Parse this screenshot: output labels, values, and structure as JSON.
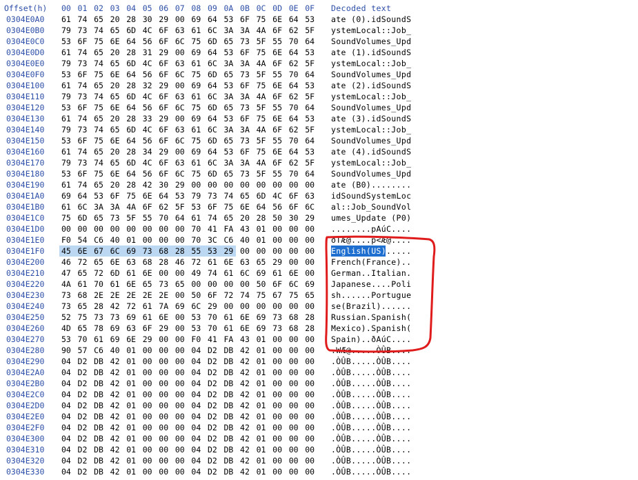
{
  "header": {
    "offset_label": "Offset(h)",
    "columns": [
      "00",
      "01",
      "02",
      "03",
      "04",
      "05",
      "06",
      "07",
      "08",
      "09",
      "0A",
      "0B",
      "0C",
      "0D",
      "0E",
      "0F"
    ],
    "decoded_label": "Decoded text"
  },
  "rows": [
    {
      "offset": "0304E0A0",
      "bytes": [
        "61",
        "74",
        "65",
        "20",
        "28",
        "30",
        "29",
        "00",
        "69",
        "64",
        "53",
        "6F",
        "75",
        "6E",
        "64",
        "53"
      ],
      "text": "ate (0).idSoundS"
    },
    {
      "offset": "0304E0B0",
      "bytes": [
        "79",
        "73",
        "74",
        "65",
        "6D",
        "4C",
        "6F",
        "63",
        "61",
        "6C",
        "3A",
        "3A",
        "4A",
        "6F",
        "62",
        "5F"
      ],
      "text": "ystemLocal::Job_"
    },
    {
      "offset": "0304E0C0",
      "bytes": [
        "53",
        "6F",
        "75",
        "6E",
        "64",
        "56",
        "6F",
        "6C",
        "75",
        "6D",
        "65",
        "73",
        "5F",
        "55",
        "70",
        "64"
      ],
      "text": "SoundVolumes_Upd"
    },
    {
      "offset": "0304E0D0",
      "bytes": [
        "61",
        "74",
        "65",
        "20",
        "28",
        "31",
        "29",
        "00",
        "69",
        "64",
        "53",
        "6F",
        "75",
        "6E",
        "64",
        "53"
      ],
      "text": "ate (1).idSoundS"
    },
    {
      "offset": "0304E0E0",
      "bytes": [
        "79",
        "73",
        "74",
        "65",
        "6D",
        "4C",
        "6F",
        "63",
        "61",
        "6C",
        "3A",
        "3A",
        "4A",
        "6F",
        "62",
        "5F"
      ],
      "text": "ystemLocal::Job_"
    },
    {
      "offset": "0304E0F0",
      "bytes": [
        "53",
        "6F",
        "75",
        "6E",
        "64",
        "56",
        "6F",
        "6C",
        "75",
        "6D",
        "65",
        "73",
        "5F",
        "55",
        "70",
        "64"
      ],
      "text": "SoundVolumes_Upd"
    },
    {
      "offset": "0304E100",
      "bytes": [
        "61",
        "74",
        "65",
        "20",
        "28",
        "32",
        "29",
        "00",
        "69",
        "64",
        "53",
        "6F",
        "75",
        "6E",
        "64",
        "53"
      ],
      "text": "ate (2).idSoundS"
    },
    {
      "offset": "0304E110",
      "bytes": [
        "79",
        "73",
        "74",
        "65",
        "6D",
        "4C",
        "6F",
        "63",
        "61",
        "6C",
        "3A",
        "3A",
        "4A",
        "6F",
        "62",
        "5F"
      ],
      "text": "ystemLocal::Job_"
    },
    {
      "offset": "0304E120",
      "bytes": [
        "53",
        "6F",
        "75",
        "6E",
        "64",
        "56",
        "6F",
        "6C",
        "75",
        "6D",
        "65",
        "73",
        "5F",
        "55",
        "70",
        "64"
      ],
      "text": "SoundVolumes_Upd"
    },
    {
      "offset": "0304E130",
      "bytes": [
        "61",
        "74",
        "65",
        "20",
        "28",
        "33",
        "29",
        "00",
        "69",
        "64",
        "53",
        "6F",
        "75",
        "6E",
        "64",
        "53"
      ],
      "text": "ate (3).idSoundS"
    },
    {
      "offset": "0304E140",
      "bytes": [
        "79",
        "73",
        "74",
        "65",
        "6D",
        "4C",
        "6F",
        "63",
        "61",
        "6C",
        "3A",
        "3A",
        "4A",
        "6F",
        "62",
        "5F"
      ],
      "text": "ystemLocal::Job_"
    },
    {
      "offset": "0304E150",
      "bytes": [
        "53",
        "6F",
        "75",
        "6E",
        "64",
        "56",
        "6F",
        "6C",
        "75",
        "6D",
        "65",
        "73",
        "5F",
        "55",
        "70",
        "64"
      ],
      "text": "SoundVolumes_Upd"
    },
    {
      "offset": "0304E160",
      "bytes": [
        "61",
        "74",
        "65",
        "20",
        "28",
        "34",
        "29",
        "00",
        "69",
        "64",
        "53",
        "6F",
        "75",
        "6E",
        "64",
        "53"
      ],
      "text": "ate (4).idSoundS"
    },
    {
      "offset": "0304E170",
      "bytes": [
        "79",
        "73",
        "74",
        "65",
        "6D",
        "4C",
        "6F",
        "63",
        "61",
        "6C",
        "3A",
        "3A",
        "4A",
        "6F",
        "62",
        "5F"
      ],
      "text": "ystemLocal::Job_"
    },
    {
      "offset": "0304E180",
      "bytes": [
        "53",
        "6F",
        "75",
        "6E",
        "64",
        "56",
        "6F",
        "6C",
        "75",
        "6D",
        "65",
        "73",
        "5F",
        "55",
        "70",
        "64"
      ],
      "text": "SoundVolumes_Upd"
    },
    {
      "offset": "0304E190",
      "bytes": [
        "61",
        "74",
        "65",
        "20",
        "28",
        "42",
        "30",
        "29",
        "00",
        "00",
        "00",
        "00",
        "00",
        "00",
        "00",
        "00"
      ],
      "text": "ate (B0)........"
    },
    {
      "offset": "0304E1A0",
      "bytes": [
        "69",
        "64",
        "53",
        "6F",
        "75",
        "6E",
        "64",
        "53",
        "79",
        "73",
        "74",
        "65",
        "6D",
        "4C",
        "6F",
        "63"
      ],
      "text": "idSoundSystemLoc"
    },
    {
      "offset": "0304E1B0",
      "bytes": [
        "61",
        "6C",
        "3A",
        "3A",
        "4A",
        "6F",
        "62",
        "5F",
        "53",
        "6F",
        "75",
        "6E",
        "64",
        "56",
        "6F",
        "6C"
      ],
      "text": "al::Job_SoundVol"
    },
    {
      "offset": "0304E1C0",
      "bytes": [
        "75",
        "6D",
        "65",
        "73",
        "5F",
        "55",
        "70",
        "64",
        "61",
        "74",
        "65",
        "20",
        "28",
        "50",
        "30",
        "29"
      ],
      "text": "umes_Update (P0)"
    },
    {
      "offset": "0304E1D0",
      "bytes": [
        "00",
        "00",
        "00",
        "00",
        "00",
        "00",
        "00",
        "00",
        "70",
        "41",
        "FA",
        "43",
        "01",
        "00",
        "00",
        "00"
      ],
      "text": "........pAúC...."
    },
    {
      "offset": "0304E1E0",
      "bytes": [
        "F0",
        "54",
        "C6",
        "40",
        "01",
        "00",
        "00",
        "00",
        "70",
        "3C",
        "C6",
        "40",
        "01",
        "00",
        "00",
        "00"
      ],
      "text": "ðTÆ@....p<Æ@...."
    },
    {
      "offset": "0304E1F0",
      "bytes": [
        "45",
        "6E",
        "67",
        "6C",
        "69",
        "73",
        "68",
        "28",
        "55",
        "53",
        "29",
        "00",
        "00",
        "00",
        "00",
        "00"
      ],
      "text": "English(US)....."
    },
    {
      "offset": "0304E200",
      "bytes": [
        "46",
        "72",
        "65",
        "6E",
        "63",
        "68",
        "28",
        "46",
        "72",
        "61",
        "6E",
        "63",
        "65",
        "29",
        "00",
        "00"
      ],
      "text": "French(France).."
    },
    {
      "offset": "0304E210",
      "bytes": [
        "47",
        "65",
        "72",
        "6D",
        "61",
        "6E",
        "00",
        "00",
        "49",
        "74",
        "61",
        "6C",
        "69",
        "61",
        "6E",
        "00"
      ],
      "text": "German..Italian."
    },
    {
      "offset": "0304E220",
      "bytes": [
        "4A",
        "61",
        "70",
        "61",
        "6E",
        "65",
        "73",
        "65",
        "00",
        "00",
        "00",
        "00",
        "50",
        "6F",
        "6C",
        "69"
      ],
      "text": "Japanese....Poli"
    },
    {
      "offset": "0304E230",
      "bytes": [
        "73",
        "68",
        "2E",
        "2E",
        "2E",
        "2E",
        "2E",
        "00",
        "50",
        "6F",
        "72",
        "74",
        "75",
        "67",
        "75",
        "65"
      ],
      "text": "sh......Portugue"
    },
    {
      "offset": "0304E240",
      "bytes": [
        "73",
        "65",
        "28",
        "42",
        "72",
        "61",
        "7A",
        "69",
        "6C",
        "29",
        "00",
        "00",
        "00",
        "00",
        "00",
        "00"
      ],
      "text": "se(Brazil)......"
    },
    {
      "offset": "0304E250",
      "bytes": [
        "52",
        "75",
        "73",
        "73",
        "69",
        "61",
        "6E",
        "00",
        "53",
        "70",
        "61",
        "6E",
        "69",
        "73",
        "68",
        "28"
      ],
      "text": "Russian.Spanish("
    },
    {
      "offset": "0304E260",
      "bytes": [
        "4D",
        "65",
        "78",
        "69",
        "63",
        "6F",
        "29",
        "00",
        "53",
        "70",
        "61",
        "6E",
        "69",
        "73",
        "68",
        "28"
      ],
      "text": "Mexico).Spanish("
    },
    {
      "offset": "0304E270",
      "bytes": [
        "53",
        "70",
        "61",
        "69",
        "6E",
        "29",
        "00",
        "00",
        "F0",
        "41",
        "FA",
        "43",
        "01",
        "00",
        "00",
        "00"
      ],
      "text": "Spain)..ðAúC...."
    },
    {
      "offset": "0304E280",
      "bytes": [
        "90",
        "57",
        "C6",
        "40",
        "01",
        "00",
        "00",
        "00",
        "04",
        "D2",
        "DB",
        "42",
        "01",
        "00",
        "00",
        "00"
      ],
      "text": ".WÆ@.....ÒÛB...."
    },
    {
      "offset": "0304E290",
      "bytes": [
        "04",
        "D2",
        "DB",
        "42",
        "01",
        "00",
        "00",
        "00",
        "04",
        "D2",
        "DB",
        "42",
        "01",
        "00",
        "00",
        "00"
      ],
      "text": ".ÒÛB.....ÒÛB...."
    },
    {
      "offset": "0304E2A0",
      "bytes": [
        "04",
        "D2",
        "DB",
        "42",
        "01",
        "00",
        "00",
        "00",
        "04",
        "D2",
        "DB",
        "42",
        "01",
        "00",
        "00",
        "00"
      ],
      "text": ".ÒÛB.....ÒÛB...."
    },
    {
      "offset": "0304E2B0",
      "bytes": [
        "04",
        "D2",
        "DB",
        "42",
        "01",
        "00",
        "00",
        "00",
        "04",
        "D2",
        "DB",
        "42",
        "01",
        "00",
        "00",
        "00"
      ],
      "text": ".ÒÛB.....ÒÛB...."
    },
    {
      "offset": "0304E2C0",
      "bytes": [
        "04",
        "D2",
        "DB",
        "42",
        "01",
        "00",
        "00",
        "00",
        "04",
        "D2",
        "DB",
        "42",
        "01",
        "00",
        "00",
        "00"
      ],
      "text": ".ÒÛB.....ÒÛB...."
    },
    {
      "offset": "0304E2D0",
      "bytes": [
        "04",
        "D2",
        "DB",
        "42",
        "01",
        "00",
        "00",
        "00",
        "04",
        "D2",
        "DB",
        "42",
        "01",
        "00",
        "00",
        "00"
      ],
      "text": ".ÒÛB.....ÒÛB...."
    },
    {
      "offset": "0304E2E0",
      "bytes": [
        "04",
        "D2",
        "DB",
        "42",
        "01",
        "00",
        "00",
        "00",
        "04",
        "D2",
        "DB",
        "42",
        "01",
        "00",
        "00",
        "00"
      ],
      "text": ".ÒÛB.....ÒÛB...."
    },
    {
      "offset": "0304E2F0",
      "bytes": [
        "04",
        "D2",
        "DB",
        "42",
        "01",
        "00",
        "00",
        "00",
        "04",
        "D2",
        "DB",
        "42",
        "01",
        "00",
        "00",
        "00"
      ],
      "text": ".ÒÛB.....ÒÛB...."
    },
    {
      "offset": "0304E300",
      "bytes": [
        "04",
        "D2",
        "DB",
        "42",
        "01",
        "00",
        "00",
        "00",
        "04",
        "D2",
        "DB",
        "42",
        "01",
        "00",
        "00",
        "00"
      ],
      "text": ".ÒÛB.....ÒÛB...."
    },
    {
      "offset": "0304E310",
      "bytes": [
        "04",
        "D2",
        "DB",
        "42",
        "01",
        "00",
        "00",
        "00",
        "04",
        "D2",
        "DB",
        "42",
        "01",
        "00",
        "00",
        "00"
      ],
      "text": ".ÒÛB.....ÒÛB...."
    },
    {
      "offset": "0304E320",
      "bytes": [
        "04",
        "D2",
        "DB",
        "42",
        "01",
        "00",
        "00",
        "00",
        "04",
        "D2",
        "DB",
        "42",
        "01",
        "00",
        "00",
        "00"
      ],
      "text": ".ÒÛB.....ÒÛB...."
    },
    {
      "offset": "0304E330",
      "bytes": [
        "04",
        "D2",
        "DB",
        "42",
        "01",
        "00",
        "00",
        "00",
        "04",
        "D2",
        "DB",
        "42",
        "01",
        "00",
        "00",
        "00"
      ],
      "text": ".ÒÛB.....ÒÛB...."
    }
  ],
  "selection": {
    "row_offset": "0304E1F0",
    "byte_count": 11
  },
  "colors": {
    "header_text": "#2d4ea8",
    "offset_text": "#2d4ea8",
    "selection_hex_bg": "#bcd7f2",
    "selection_text_bg": "#1e6fd0",
    "annotation_stroke": "#e01b1b"
  }
}
